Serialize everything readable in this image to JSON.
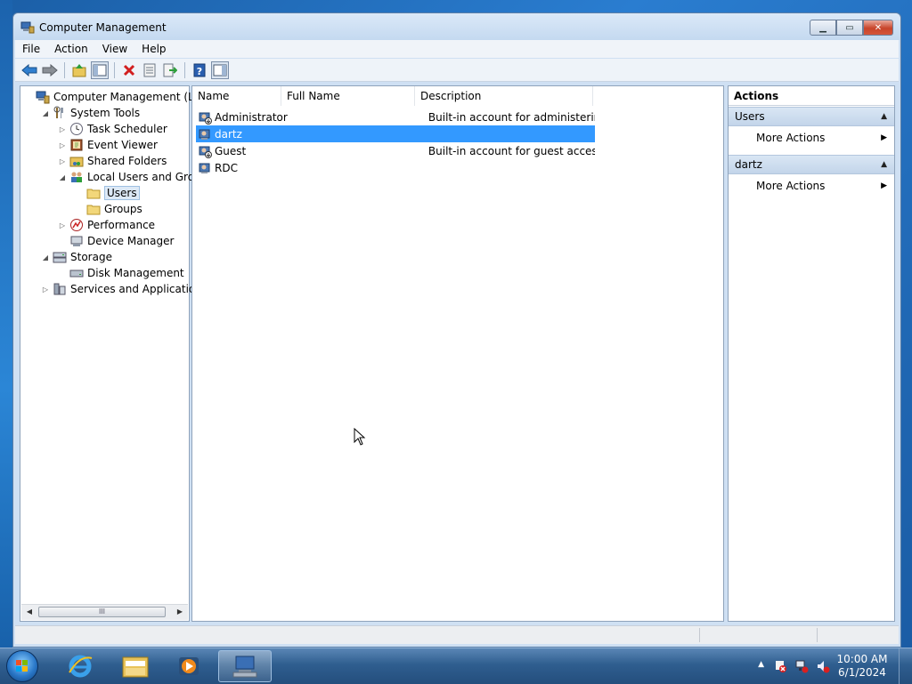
{
  "window": {
    "title": "Computer Management",
    "controls": {
      "minimize": "▁",
      "maximize": "▭",
      "close": "✕"
    }
  },
  "menu": [
    "File",
    "Action",
    "View",
    "Help"
  ],
  "toolbar": {
    "icons": [
      "back-icon",
      "forward-icon",
      "up-icon",
      "show-hide-tree-icon",
      "delete-icon",
      "properties-icon",
      "export-list-icon",
      "help-icon",
      "show-hide-action-pane-icon"
    ]
  },
  "tree": {
    "items": [
      {
        "label": "Computer Management (Local",
        "indent": 0,
        "twisty": "",
        "icon": "computer-management-icon"
      },
      {
        "label": "System Tools",
        "indent": 1,
        "twisty": "◢",
        "icon": "tools-icon"
      },
      {
        "label": "Task Scheduler",
        "indent": 2,
        "twisty": "▷",
        "icon": "clock-icon"
      },
      {
        "label": "Event Viewer",
        "indent": 2,
        "twisty": "▷",
        "icon": "event-viewer-icon"
      },
      {
        "label": "Shared Folders",
        "indent": 2,
        "twisty": "▷",
        "icon": "shared-folder-icon"
      },
      {
        "label": "Local Users and Groups",
        "indent": 2,
        "twisty": "◢",
        "icon": "users-groups-icon"
      },
      {
        "label": "Users",
        "indent": 3,
        "twisty": "",
        "icon": "folder-icon",
        "selected": true
      },
      {
        "label": "Groups",
        "indent": 3,
        "twisty": "",
        "icon": "folder-icon"
      },
      {
        "label": "Performance",
        "indent": 2,
        "twisty": "▷",
        "icon": "performance-icon"
      },
      {
        "label": "Device Manager",
        "indent": 2,
        "twisty": "",
        "icon": "device-manager-icon"
      },
      {
        "label": "Storage",
        "indent": 1,
        "twisty": "◢",
        "icon": "storage-icon"
      },
      {
        "label": "Disk Management",
        "indent": 2,
        "twisty": "",
        "icon": "disk-icon"
      },
      {
        "label": "Services and Applications",
        "indent": 1,
        "twisty": "▷",
        "icon": "services-icon"
      }
    ],
    "scrollbar_grip": "III"
  },
  "list": {
    "columns": [
      "Name",
      "Full Name",
      "Description"
    ],
    "rows": [
      {
        "name": "Administrator",
        "full_name": "",
        "description": "Built-in account for administering...",
        "icon": "disabled-user-icon"
      },
      {
        "name": "dartz",
        "full_name": "",
        "description": "",
        "icon": "user-icon",
        "selected": true
      },
      {
        "name": "Guest",
        "full_name": "",
        "description": "Built-in account for guest access t...",
        "icon": "disabled-user-icon"
      },
      {
        "name": "RDC",
        "full_name": "",
        "description": "",
        "icon": "user-icon"
      }
    ]
  },
  "actions": {
    "title": "Actions",
    "groups": [
      {
        "label": "Users",
        "items": [
          "More Actions"
        ]
      },
      {
        "label": "dartz",
        "items": [
          "More Actions"
        ]
      }
    ]
  },
  "taskbar": {
    "apps": [
      "internet-explorer-icon",
      "explorer-icon",
      "media-player-icon",
      "computer-management-icon"
    ],
    "active_app": "computer-management-icon",
    "tray_icons": [
      "show-hidden-icons-icon",
      "action-center-icon",
      "network-icon",
      "volume-muted-icon"
    ],
    "time": "10:00 AM",
    "date": "6/1/2024"
  },
  "colors": {
    "selection": "#3399ff",
    "window_frame": "#cfe0f3"
  }
}
